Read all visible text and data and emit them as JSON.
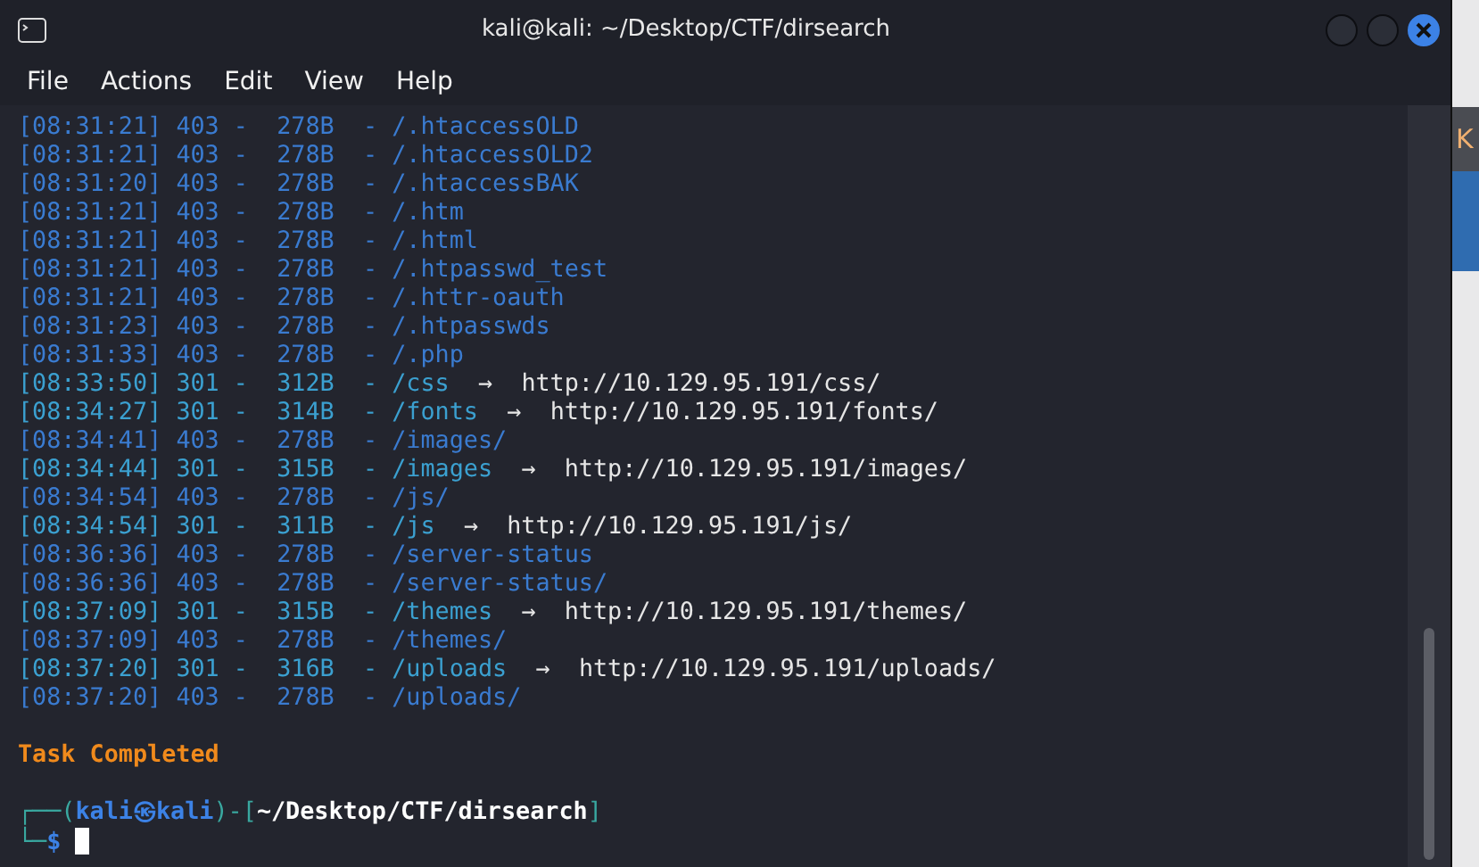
{
  "window": {
    "title": "kali@kali: ~/Desktop/CTF/dirsearch"
  },
  "menu": [
    "File",
    "Actions",
    "Edit",
    "View",
    "Help"
  ],
  "log": [
    {
      "kind": "forbidden",
      "time": "[08:31:21]",
      "status": "403 -",
      "size": "278B",
      "path": "- /.htaccessOLD"
    },
    {
      "kind": "forbidden",
      "time": "[08:31:21]",
      "status": "403 -",
      "size": "278B",
      "path": "- /.htaccessOLD2"
    },
    {
      "kind": "forbidden",
      "time": "[08:31:20]",
      "status": "403 -",
      "size": "278B",
      "path": "- /.htaccessBAK"
    },
    {
      "kind": "forbidden",
      "time": "[08:31:21]",
      "status": "403 -",
      "size": "278B",
      "path": "- /.htm"
    },
    {
      "kind": "forbidden",
      "time": "[08:31:21]",
      "status": "403 -",
      "size": "278B",
      "path": "- /.html"
    },
    {
      "kind": "forbidden",
      "time": "[08:31:21]",
      "status": "403 -",
      "size": "278B",
      "path": "- /.htpasswd_test"
    },
    {
      "kind": "forbidden",
      "time": "[08:31:21]",
      "status": "403 -",
      "size": "278B",
      "path": "- /.httr-oauth"
    },
    {
      "kind": "forbidden",
      "time": "[08:31:23]",
      "status": "403 -",
      "size": "278B",
      "path": "- /.htpasswds"
    },
    {
      "kind": "forbidden",
      "time": "[08:31:33]",
      "status": "403 -",
      "size": "278B",
      "path": "- /.php"
    },
    {
      "kind": "redirect",
      "time": "[08:33:50]",
      "status": "301 -",
      "size": "312B",
      "path": "- /css",
      "arrow": "→",
      "target": "http://10.129.95.191/css/"
    },
    {
      "kind": "redirect",
      "time": "[08:34:27]",
      "status": "301 -",
      "size": "314B",
      "path": "- /fonts",
      "arrow": "→",
      "target": "http://10.129.95.191/fonts/"
    },
    {
      "kind": "forbidden",
      "time": "[08:34:41]",
      "status": "403 -",
      "size": "278B",
      "path": "- /images/"
    },
    {
      "kind": "redirect",
      "time": "[08:34:44]",
      "status": "301 -",
      "size": "315B",
      "path": "- /images",
      "arrow": "→",
      "target": "http://10.129.95.191/images/"
    },
    {
      "kind": "forbidden",
      "time": "[08:34:54]",
      "status": "403 -",
      "size": "278B",
      "path": "- /js/"
    },
    {
      "kind": "redirect",
      "time": "[08:34:54]",
      "status": "301 -",
      "size": "311B",
      "path": "- /js",
      "arrow": "→",
      "target": "http://10.129.95.191/js/"
    },
    {
      "kind": "forbidden",
      "time": "[08:36:36]",
      "status": "403 -",
      "size": "278B",
      "path": "- /server-status"
    },
    {
      "kind": "forbidden",
      "time": "[08:36:36]",
      "status": "403 -",
      "size": "278B",
      "path": "- /server-status/"
    },
    {
      "kind": "redirect",
      "time": "[08:37:09]",
      "status": "301 -",
      "size": "315B",
      "path": "- /themes",
      "arrow": "→",
      "target": "http://10.129.95.191/themes/"
    },
    {
      "kind": "forbidden",
      "time": "[08:37:09]",
      "status": "403 -",
      "size": "278B",
      "path": "- /themes/"
    },
    {
      "kind": "redirect",
      "time": "[08:37:20]",
      "status": "301 -",
      "size": "316B",
      "path": "- /uploads",
      "arrow": "→",
      "target": "http://10.129.95.191/uploads/"
    },
    {
      "kind": "forbidden",
      "time": "[08:37:20]",
      "status": "403 -",
      "size": "278B",
      "path": "- /uploads/"
    }
  ],
  "summary": "Task Completed",
  "prompt": {
    "corner_top": "┌──(",
    "user": "kali㉿kali",
    "separator": ")-[",
    "cwd": "~/Desktop/CTF/dirsearch",
    "close": "]",
    "corner_bottom": "└─",
    "symbol": "$"
  },
  "background_window": {
    "text": "K"
  }
}
